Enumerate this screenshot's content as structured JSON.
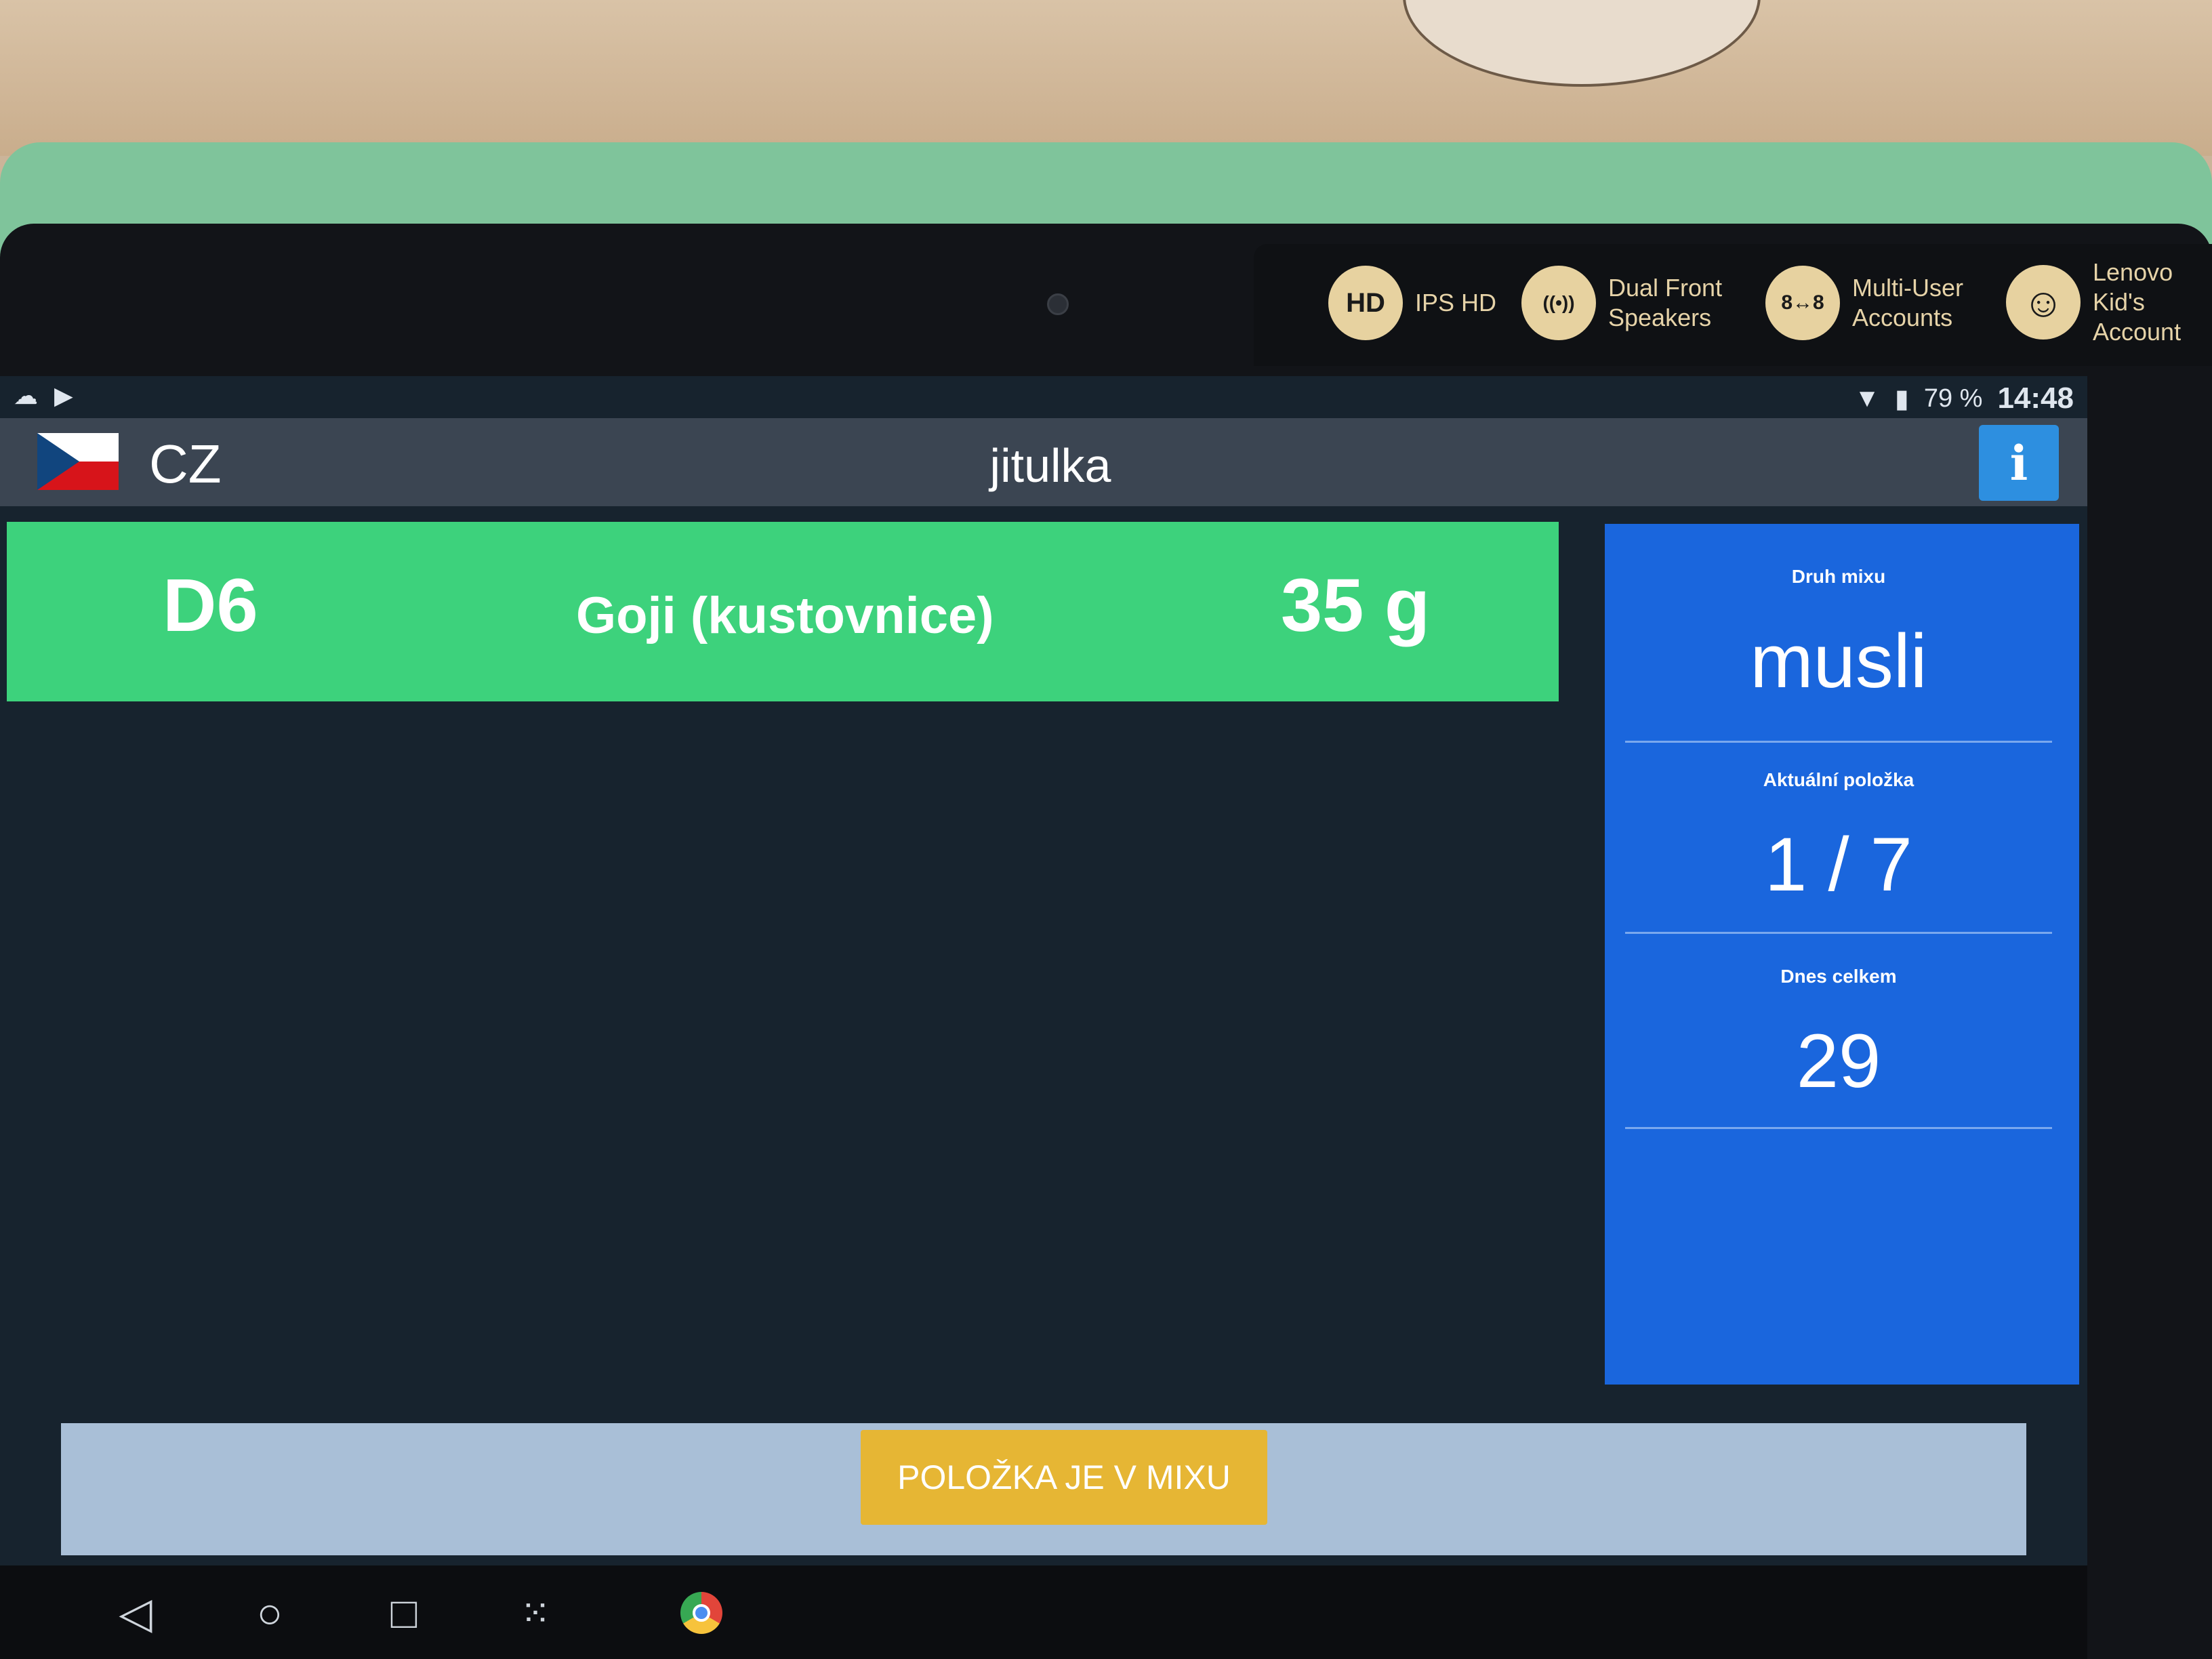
{
  "case_features": [
    {
      "icon": "hd-icon",
      "glyph": "HD",
      "text": "IPS HD"
    },
    {
      "icon": "speaker-icon",
      "glyph": "((•))",
      "text": "Dual Front\nSpeakers"
    },
    {
      "icon": "users-icon",
      "glyph": "8↔8",
      "text": "Multi-User\nAccounts"
    },
    {
      "icon": "kids-icon",
      "glyph": "☺",
      "text": "Lenovo\nKid's\nAccount"
    }
  ],
  "statusbar": {
    "left_icons": [
      "cloud-icon",
      "play-store-icon"
    ],
    "battery": "79 %",
    "time": "14:48"
  },
  "header": {
    "language": "CZ",
    "user": "jitulka",
    "info_label": "i"
  },
  "current_item": {
    "code": "D6",
    "name": "Goji (kustovnice)",
    "quantity": "35 g"
  },
  "sidebar": {
    "mix_type_label": "Druh mixu",
    "mix_type_value": "musli",
    "current_item_label": "Aktuální položka",
    "current_item_value": "1 / 7",
    "today_total_label": "Dnes celkem",
    "today_total_value": "29"
  },
  "actions": {
    "item_in_mix": "POLOŽKA JE V MIXU"
  },
  "navbar": [
    "back-icon",
    "home-icon",
    "recents-icon",
    "apps-icon",
    "chrome-icon"
  ],
  "colors": {
    "item_row": "#3dd27c",
    "sidebar": "#1a66dd",
    "action_button": "#e6b634",
    "info_button": "#2d8fe0"
  }
}
